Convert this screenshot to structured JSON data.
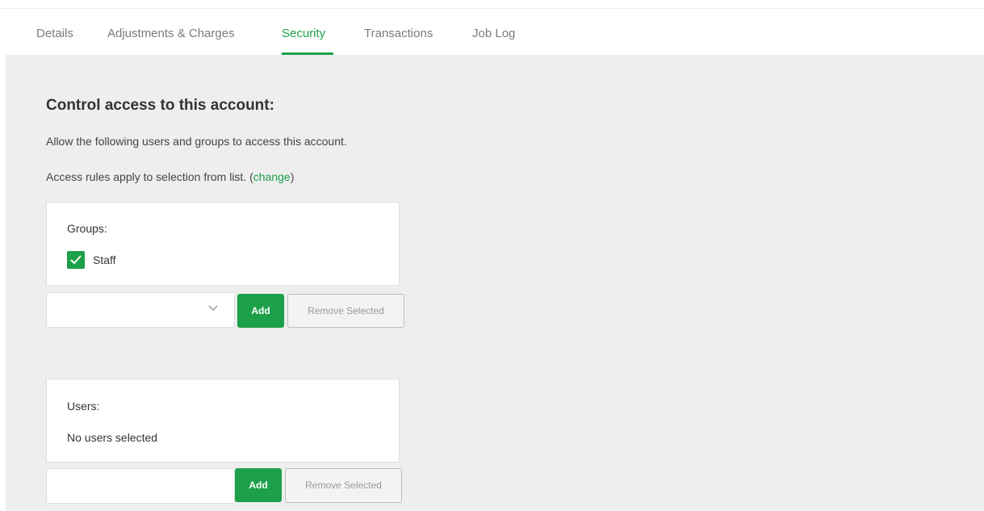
{
  "tabs": [
    {
      "label": "Details"
    },
    {
      "label": "Adjustments & Charges"
    },
    {
      "label": "Security",
      "active": true
    },
    {
      "label": "Transactions"
    },
    {
      "label": "Job Log"
    }
  ],
  "section": {
    "heading": "Control access to this account:",
    "intro": "Allow the following users and groups to access this account.",
    "rules_prefix": "Access rules apply to selection from list. (",
    "rules_link": "change",
    "rules_suffix": ")"
  },
  "groups": {
    "label": "Groups:",
    "items": [
      {
        "name": "Staff",
        "checked": true
      }
    ],
    "select_value": "",
    "add_label": "Add",
    "remove_label": "Remove Selected"
  },
  "users": {
    "label": "Users:",
    "empty_text": "No users selected",
    "input_value": "",
    "add_label": "Add",
    "remove_label": "Remove Selected"
  },
  "colors": {
    "accent": "#1ca04a",
    "panel_bg": "#eeeeef"
  },
  "icons": {
    "checkbox": "checkmark-icon",
    "dropdown": "chevron-down-icon"
  }
}
